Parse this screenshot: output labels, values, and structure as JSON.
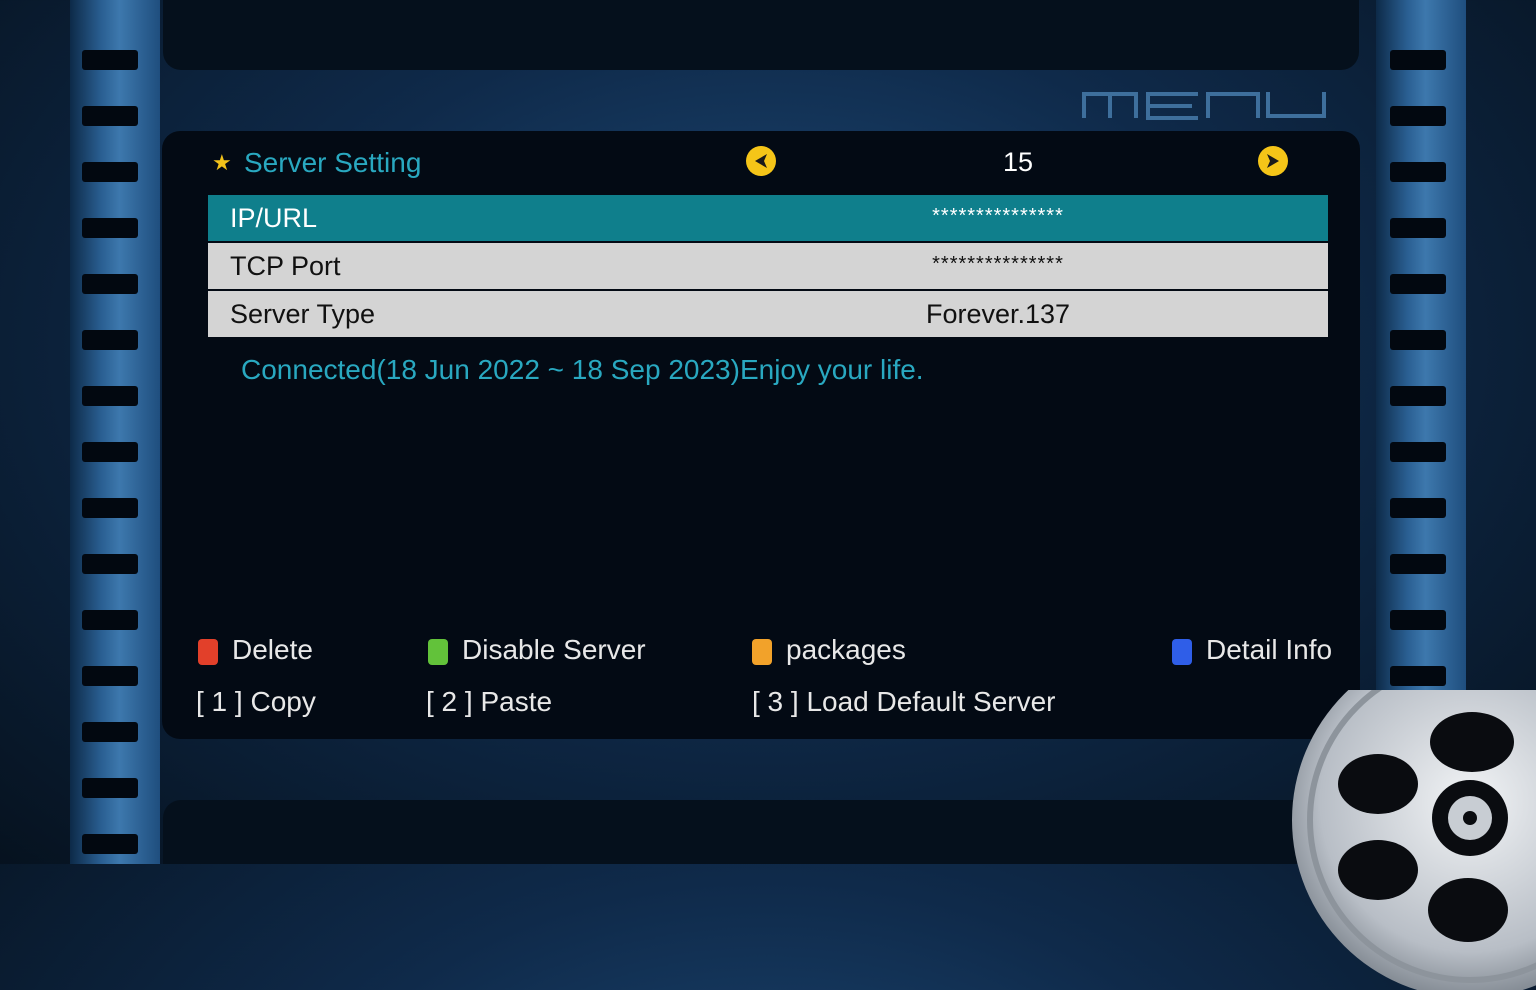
{
  "logo_text": "MENU",
  "header": {
    "title": "Server Setting",
    "star_icon": "star-icon",
    "page_number": "15",
    "prev_icon": "left-arrow-icon",
    "next_icon": "right-arrow-icon"
  },
  "rows": [
    {
      "label": "IP/URL",
      "value": "***************",
      "selected": true
    },
    {
      "label": "TCP Port",
      "value": "***************",
      "selected": false
    },
    {
      "label": "Server Type",
      "value": "Forever.137",
      "selected": false
    }
  ],
  "status": "Connected(18 Jun 2022 ~ 18 Sep 2023)Enjoy your life.",
  "color_keys": [
    {
      "color": "#e2402a",
      "label": "Delete"
    },
    {
      "color": "#62c23a",
      "label": "Disable Server"
    },
    {
      "color": "#f2a22a",
      "label": "packages"
    },
    {
      "color": "#2f5ee8",
      "label": "Detail Info"
    }
  ],
  "shortcuts": [
    {
      "label": "[ 1 ] Copy"
    },
    {
      "label": "[ 2 ] Paste"
    },
    {
      "label": "[ 3 ] Load Default Server"
    }
  ],
  "colors": {
    "accent": "#29a8c0",
    "selected_row": "#0f7f8c",
    "row_bg": "#d4d4d4",
    "arrow": "#f5c518"
  }
}
